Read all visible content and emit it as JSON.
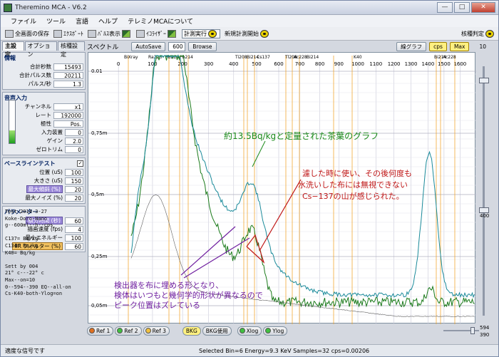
{
  "window": {
    "title": "Theremino MCA - V6.2"
  },
  "menu": [
    "ファイル",
    "ツール",
    "言語",
    "ヘルプ",
    "テレミノMCAについて"
  ],
  "toolbar": {
    "save_screen": "全画面の保存",
    "export": "ｴｸｽﾎﾟｰﾄ",
    "pulse_display": "ﾊﾟﾙｽ表示",
    "equalizer": "ｲｺﾗｲｻﾞｰ",
    "measure": "計測実行",
    "new_measure": "新規計測開始",
    "nuclide_id": "核種判定"
  },
  "tabs": [
    "主設定",
    "オプション",
    "核種設定"
  ],
  "info": {
    "title": "情報",
    "rows": [
      {
        "label": "合計秒数",
        "value": "15493"
      },
      {
        "label": "合計パルス数",
        "value": "20211"
      },
      {
        "label": "パルス/秒",
        "value": "1.3"
      }
    ]
  },
  "audio": {
    "title": "音声入力",
    "level": 0.3,
    "rows": [
      {
        "label": "チャンネル",
        "value": "x1"
      },
      {
        "label": "レート",
        "value": "192000"
      },
      {
        "label": "極性",
        "value": "Pos."
      },
      {
        "label": "入力装置",
        "value": "0"
      },
      {
        "label": "ゲイン",
        "value": "2.0"
      },
      {
        "label": "ゼロトリム",
        "value": "0"
      }
    ]
  },
  "baseline": {
    "title": "ベースラインテスト",
    "rows": [
      {
        "label": "位置 (uS)",
        "value": "100"
      },
      {
        "label": "大きさ (uS)",
        "value": "150"
      },
      {
        "button": "最大傾斜 (%)",
        "value": "20"
      },
      {
        "label": "最大ノイズ (%)",
        "value": "20"
      }
    ]
  },
  "params": {
    "title": "パラメーター",
    "rows": [
      {
        "button": "積分時間 (秒)",
        "value": "60"
      },
      {
        "label": "描画速度 (fps)",
        "value": "4"
      },
      {
        "label": "最小エネルギー",
        "value": "100"
      },
      {
        "button": "IIR フィルター (%)",
        "value": "60"
      }
    ]
  },
  "notes": [
    "Test-2014-3-27",
    "Koke-Doro-Nano",
    "g--600ml--h--cps",
    "",
    "C137= Bq/kg",
    "C134= Bq/kg",
    "K40= Bq/kg",
    "",
    "Sett by 004",
    "21° c---22° c",
    "Max--on=10",
    "0--594--390  EQ--all-on",
    "Cs-K40-both-Ylog=on"
  ],
  "spectrum_bar": {
    "label": "スペクトル",
    "autosave": "AutoSave",
    "value": "600",
    "browse": "Browse",
    "line_graph": "線グラフ",
    "cps": "cps",
    "max": "Max",
    "right_value": "10"
  },
  "bottom": {
    "ref1": "Ref 1",
    "ref2": "Ref 2",
    "ref3": "Ref 3",
    "bkg": "BKG",
    "bkg_use": "BKG使用",
    "xlog": "Xlog",
    "ylog": "Ylog",
    "v594": "594",
    "v390": "390"
  },
  "status": {
    "signal": "適度な信号です",
    "info": "Selected Bin=6  Energy=9.3 KeV  Samples=32  cps=0.00206"
  },
  "scale_right": {
    "top": "10",
    "mid": "400"
  },
  "chart_data": {
    "type": "line",
    "y_ticks": [
      "0.01",
      "0,75m",
      "0,5m",
      "0,25m",
      "0,05m"
    ],
    "x_ticks": [
      "0",
      "100",
      "200",
      "300",
      "400",
      "500",
      "600",
      "700",
      "800",
      "900",
      "1000",
      "1100",
      "1200",
      "1300",
      "1400",
      "1500",
      "1600"
    ],
    "nuclide_labels": [
      "BiXray",
      "Ra226",
      "Pb214",
      "Pb214",
      "Ti208",
      "Bi214",
      "Cs137",
      "Tl208",
      "Ac228",
      "Bi214",
      "K40",
      "Bi214",
      "Ac228"
    ],
    "annotations": [
      "約13.5Bq/kgと定量された茶葉のグラフ",
      "濾した時に使い、その後何度も",
      "水洗いした布には無視できない",
      "Cs−137の山が感じられた。",
      "検出器を布に埋める形となり、",
      "検体はいつもと幾何学的形状が異なるので",
      "ピーク位置はズレている"
    ],
    "series": [
      {
        "color": "#1a7a1a"
      },
      {
        "color": "#1a8a9a"
      },
      {
        "color": "#606060"
      }
    ]
  }
}
